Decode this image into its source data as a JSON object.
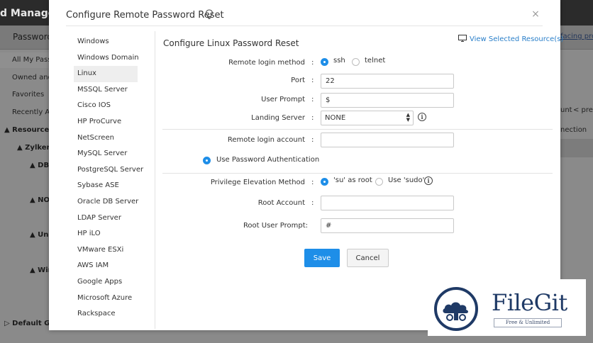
{
  "background": {
    "brand": "d Manager",
    "subtitle": "Password",
    "right_link": "facing prob",
    "sidebar_items": [
      "All My Passw",
      "Owned and",
      "Favorites",
      "Recently Ac"
    ],
    "tree": [
      "Resource G",
      "Zylker",
      "DBA",
      "NO",
      "Uni",
      "Win",
      "Default Gr"
    ],
    "right_texts": [
      "unt",
      "< prev",
      "nection"
    ]
  },
  "modal": {
    "title": "Configure Remote Password Reset",
    "icons": {
      "title_icon": "lightbulb-icon",
      "close": "close-icon",
      "view_resources": "monitor-icon",
      "info": "info-icon"
    },
    "close_label": "×",
    "resource_types": [
      "Windows",
      "Windows Domain",
      "Linux",
      "MSSQL Server",
      "Cisco IOS",
      "HP ProCurve",
      "NetScreen",
      "MySQL Server",
      "PostgreSQL Server",
      "Sybase ASE",
      "Oracle DB Server",
      "LDAP Server",
      "HP iLO",
      "VMware ESXi",
      "AWS IAM",
      "Google Apps",
      "Microsoft Azure",
      "Rackspace"
    ],
    "selected_resource_type": "Linux",
    "content_title": "Configure Linux Password Reset",
    "view_selected_resources": "View Selected Resource(s)",
    "form": {
      "remote_login_method": {
        "label": "Remote login method",
        "options": [
          "ssh",
          "telnet"
        ],
        "selected": "ssh"
      },
      "port": {
        "label": "Port",
        "value": "22"
      },
      "user_prompt": {
        "label": "User Prompt",
        "value": "$"
      },
      "landing_server": {
        "label": "Landing Server",
        "value": "NONE"
      },
      "remote_login_account": {
        "label": "Remote login account",
        "value": ""
      },
      "use_password_auth": {
        "label": "Use Password Authentication",
        "selected": true
      },
      "privilege_elevation": {
        "label": "Privilege Elevation Method",
        "options": [
          "'su' as root",
          "Use 'sudo'"
        ],
        "selected": "'su' as root"
      },
      "root_account": {
        "label": "Root Account",
        "value": ""
      },
      "root_user_prompt": {
        "label": "Root User Prompt:",
        "value": "#"
      },
      "colon": ":"
    },
    "buttons": {
      "save": "Save",
      "cancel": "Cancel"
    }
  },
  "watermark": {
    "name": "FileGit",
    "tagline": "Free & Unlimited"
  },
  "colors": {
    "accent": "#1e8ee8",
    "link": "#2a7fc9",
    "watermark": "#1f3a66"
  }
}
